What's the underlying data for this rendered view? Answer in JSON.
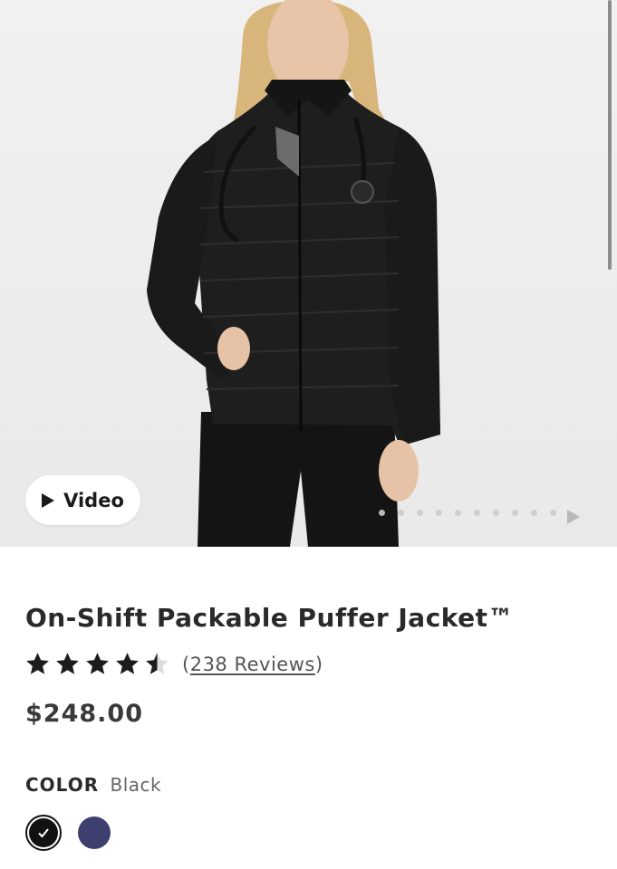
{
  "hero": {
    "photo_icon": "person-wearing-black-puffer-jacket-photo",
    "video_button_label": "Video",
    "carousel_dots": 10,
    "carousel_active_index": 0
  },
  "product": {
    "title": "On-Shift Packable Puffer Jacket™",
    "rating_out_of_5": 4.5,
    "reviews_open": "(",
    "reviews_label": "238 Reviews",
    "reviews_close": ")",
    "price": "$248.00"
  },
  "color": {
    "label": "COLOR",
    "selected_value": "Black",
    "swatches": [
      {
        "name": "Black",
        "hex": "#111111",
        "selected": true
      },
      {
        "name": "Navy",
        "hex": "#3d3f6e",
        "selected": false
      }
    ]
  }
}
